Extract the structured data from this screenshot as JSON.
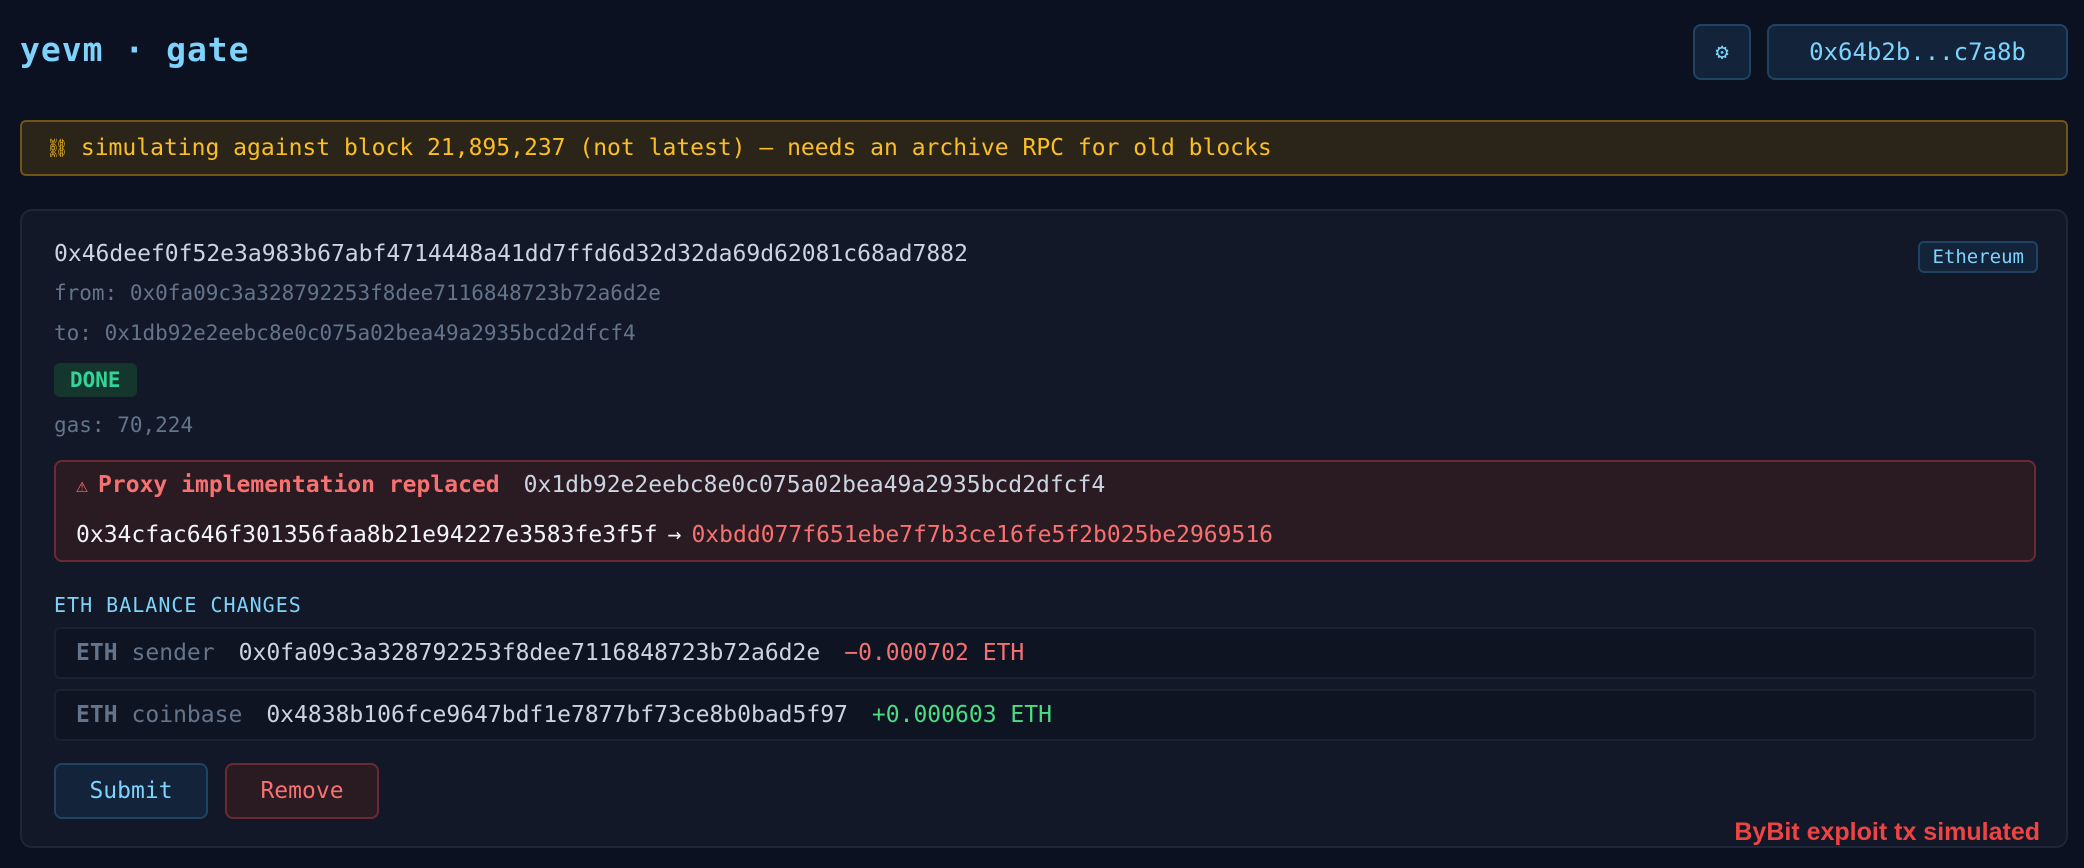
{
  "header": {
    "title": "yevm · gate",
    "settings_icon": "⚙",
    "wallet_address": "0x64b2b...c7a8b"
  },
  "banner": {
    "icon": "⛓",
    "text": "simulating against block 21,895,237 (not latest) — needs an archive RPC for old blocks"
  },
  "tx": {
    "hash": "0x46deef0f52e3a983b67abf4714448a41dd7ffd6d32d32da69d62081c68ad7882",
    "chain": "Ethereum",
    "from_label": "from:",
    "from": "0x0fa09c3a328792253f8dee7116848723b72a6d2e",
    "to_label": "to:",
    "to": "0x1db92e2eebc8e0c075a02bea49a2935bcd2dfcf4",
    "status": "DONE",
    "gas_label": "gas:",
    "gas": "70,224"
  },
  "alert": {
    "icon": "⚠",
    "title": "Proxy implementation replaced",
    "proxy_address": "0x1db92e2eebc8e0c075a02bea49a2935bcd2dfcf4",
    "old_impl": "0x34cfac646f301356faa8b21e94227e3583fe3f5f",
    "arrow": "→",
    "new_impl": "0xbdd077f651ebe7f7b3ce16fe5f2b025be2969516"
  },
  "balances": {
    "title": "ETH BALANCE CHANGES",
    "rows": [
      {
        "token": "ETH",
        "role": "sender",
        "address": "0x0fa09c3a328792253f8dee7116848723b72a6d2e",
        "delta": "−0.000702 ETH"
      },
      {
        "token": "ETH",
        "role": "coinbase",
        "address": "0x4838b106fce9647bdf1e7877bf73ce8b0bad5f97",
        "delta": "+0.000603 ETH"
      }
    ]
  },
  "actions": {
    "submit_label": "Submit",
    "remove_label": "Remove"
  },
  "caption": "ByBit exploit tx simulated",
  "colors": {
    "background": "#0b1120",
    "accent": "#7dd3fc",
    "warning": "#fbbf24",
    "danger": "#f87171",
    "success": "#4ade80"
  }
}
